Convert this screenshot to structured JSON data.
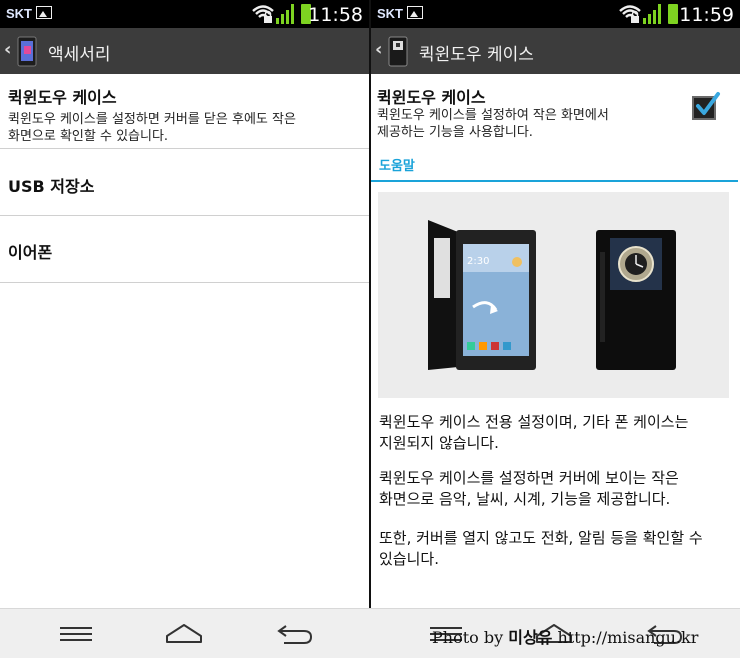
{
  "left": {
    "status": {
      "carrier": "SKT",
      "time": "11:58"
    },
    "actionbar": {
      "title": "액세서리"
    },
    "items": [
      {
        "title": "퀵윈도우 케이스",
        "subtitle_line1": "퀵윈도우 케이스를 설정하면 커버를 닫은 후에도 작은",
        "subtitle_line2": "화면으로 확인할 수 있습니다."
      },
      {
        "title": "USB 저장소"
      },
      {
        "title": "이어폰"
      }
    ]
  },
  "right": {
    "status": {
      "carrier": "SKT",
      "time": "11:59"
    },
    "actionbar": {
      "title": "퀵윈도우 케이스"
    },
    "setting": {
      "title": "퀵윈도우 케이스",
      "subtitle_line1": "퀵윈도우 케이스를 설정하여 작은 화면에서",
      "subtitle_line2": "제공하는 기능을 사용합니다.",
      "checked": true
    },
    "help": {
      "header": "도움말",
      "image_clock": "2:30",
      "p1_line1": "퀵윈도우 케이스 전용 설정이며, 기타 폰 케이스는",
      "p1_line2": "지원되지 않습니다.",
      "p2_line1": "퀵윈도우 케이스를 설정하면 커버에 보이는 작은",
      "p2_line2": "화면으로 음악, 날씨, 시계, 기능을 제공합니다.",
      "p3_line1": "또한, 커버를 열지 않고도 전화, 알림 등을 확인할 수",
      "p3_line2": "있습니다."
    }
  },
  "navbar": {
    "buttons": [
      "menu-icon",
      "home-icon",
      "back-icon"
    ]
  },
  "watermark": {
    "prefix": "Photo by",
    "name": "미상유",
    "url": "http://misangu.kr"
  },
  "colors": {
    "accent": "#1aa3d9",
    "status_green": "#7ed321",
    "actionbar": "#3c3c3c"
  }
}
